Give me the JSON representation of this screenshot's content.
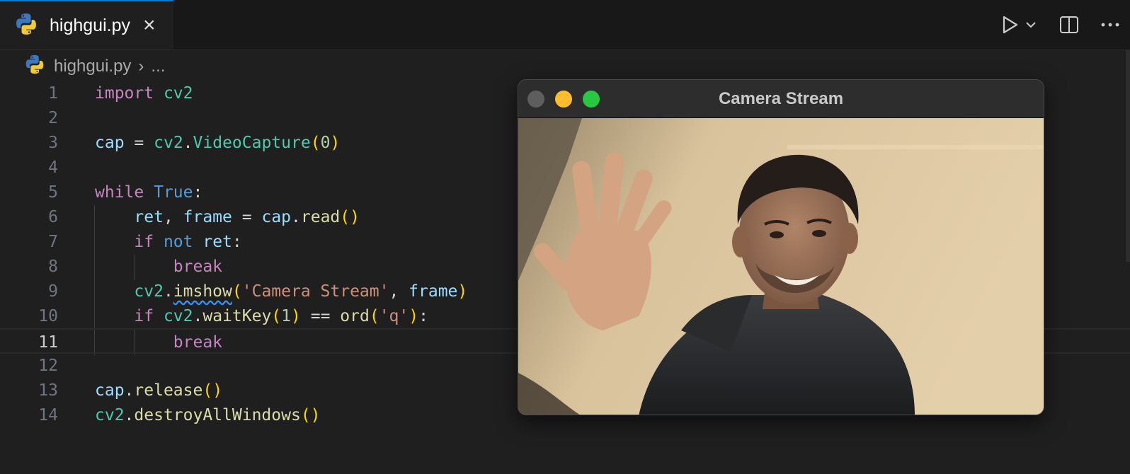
{
  "tab": {
    "label": "highgui.py",
    "close": "×"
  },
  "breadcrumb": {
    "file": "highgui.py",
    "sep": "›",
    "more": "..."
  },
  "editor": {
    "current_line": 11,
    "line_numbers": [
      "1",
      "2",
      "3",
      "4",
      "5",
      "6",
      "7",
      "8",
      "9",
      "10",
      "11",
      "12",
      "13",
      "14"
    ]
  },
  "camera_window": {
    "title": "Camera Stream"
  },
  "colors": {
    "accent": "#0078d4",
    "keyword": "#c586c0",
    "module": "#4ec9b0",
    "function": "#dcdcaa",
    "variable": "#9cdcfe",
    "string": "#ce9178"
  },
  "icons": {
    "file_type": "python-icon",
    "run": "play-icon",
    "run_menu": "chevron-down-icon",
    "split": "split-editor-icon",
    "more": "ellipsis-icon"
  }
}
